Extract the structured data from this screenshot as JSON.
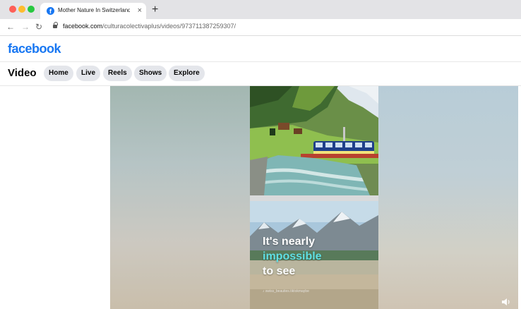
{
  "browser": {
    "tab_title": "Mother Nature In Switzerland",
    "tab_close": "×",
    "new_tab": "+",
    "url_host": "facebook.com",
    "url_path": "/culturacolectivaplus/videos/973711387259307/",
    "nav_back": "←",
    "nav_forward": "→",
    "nav_reload": "↻"
  },
  "header": {
    "logo": "facebook"
  },
  "video_nav": {
    "title": "Video",
    "tabs": [
      "Home",
      "Live",
      "Reels",
      "Shows",
      "Explore"
    ]
  },
  "player": {
    "caption_line1": "It's nearly",
    "caption_line2": "impossible",
    "caption_line3": "to see",
    "handle": "♪ swiss_beauties.tiktokmaybe",
    "caption_highlight_color": "#5fe0e4",
    "volume_icon": "speaker-icon"
  },
  "colors": {
    "brand": "#1877f2",
    "pill_bg": "#e4e6eb"
  }
}
